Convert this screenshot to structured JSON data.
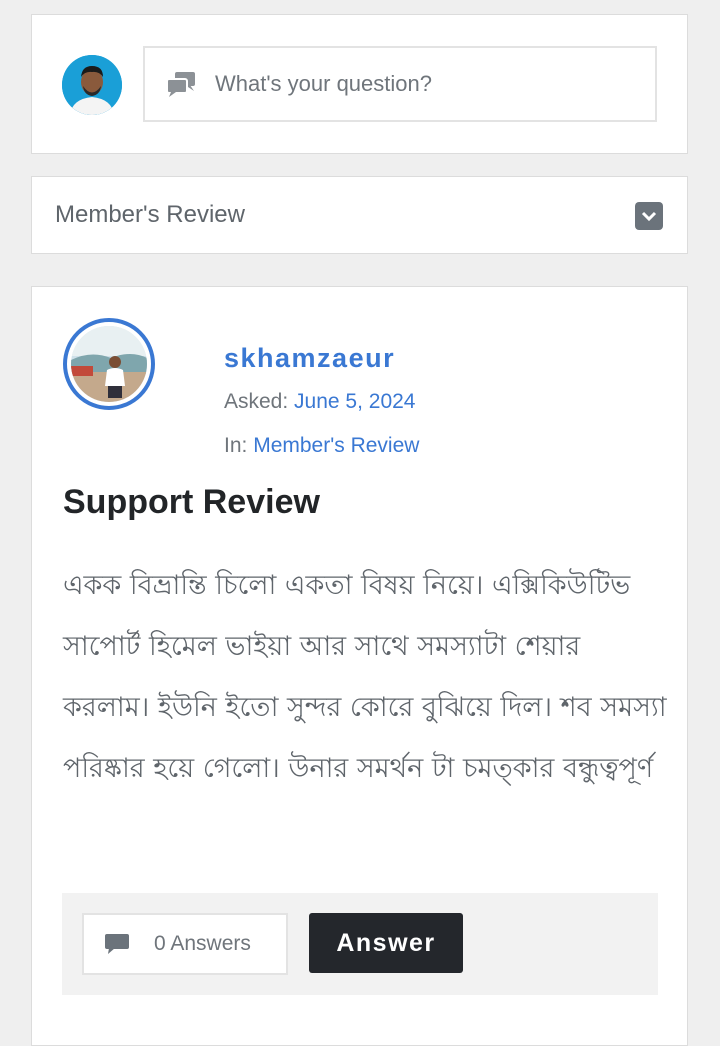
{
  "ask": {
    "placeholder": "What's your question?",
    "chat_icon": "chat-bubbles-icon"
  },
  "category_filter": {
    "label": "Member's Review",
    "dropdown_icon": "chevron-down-icon"
  },
  "question": {
    "author": "skhamzaeur",
    "asked_label": "Asked:",
    "asked_date": "June 5, 2024",
    "in_label": "In:",
    "category": "Member's Review",
    "title": "Support Review",
    "body": "একক বিভ্রান্তি চিলো একতা বিষয় নিয়ে। এক্সিকিউটিভ সাপোর্ট হিমেল ভাইয়া আর সাথে সমস্যাটা শেয়ার করলাম। ইউনি ইতো সুন্দর কোরে বুঝিয়ে দিল। শব সমস্যা পরিষ্কার হয়ে গেলো। উনার সমর্থন টা চমত্কার বন্ধুত্বপূর্ণ",
    "answers_count_label": "0 Answers",
    "answer_button": "Answer"
  },
  "colors": {
    "accent": "#3a78d3",
    "dark_button": "#24272c",
    "background": "#efefef"
  }
}
